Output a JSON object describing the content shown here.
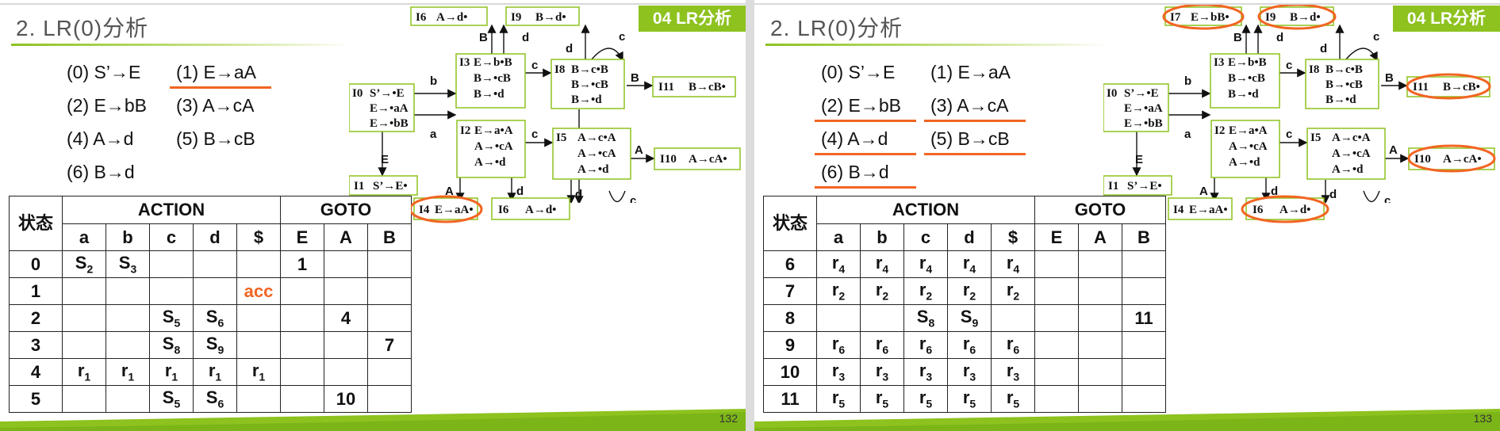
{
  "slides": [
    {
      "badge": "04 LR分析",
      "title": "2. LR(0)分析",
      "page": "132",
      "productions": [
        "(0)  S’→E",
        "(1)  E→aA",
        "(2)  E→bB",
        "(3)  A→cA",
        "(4)  A→d",
        "(5)  B→cB",
        "(6)  B→d"
      ],
      "underlined": [
        "(1)"
      ],
      "headers": {
        "state": "状态",
        "action": "ACTION",
        "goto": "GOTO",
        "cols": [
          "a",
          "b",
          "c",
          "d",
          "$",
          "E",
          "A",
          "B"
        ]
      },
      "rows": [
        [
          "0",
          "S2",
          "S3",
          "",
          "",
          "",
          "1",
          "",
          ""
        ],
        [
          "1",
          "",
          "",
          "",
          "",
          "acc",
          "",
          "",
          ""
        ],
        [
          "2",
          "",
          "",
          "S5",
          "S6",
          "",
          "",
          "4",
          ""
        ],
        [
          "3",
          "",
          "",
          "S8",
          "S9",
          "",
          "",
          "",
          "7"
        ],
        [
          "4",
          "r1",
          "r1",
          "r1",
          "r1",
          "r1",
          "",
          "",
          ""
        ],
        [
          "5",
          "",
          "",
          "S5",
          "S6",
          "",
          "",
          "10",
          ""
        ]
      ],
      "circled_states": [
        "I4"
      ]
    },
    {
      "badge": "04 LR分析",
      "title": "2. LR(0)分析",
      "page": "133",
      "productions": [
        "(0)  S’→E",
        "(1)  E→aA",
        "(2)  E→bB",
        "(3)  A→cA",
        "(4)  A→d",
        "(5)  B→cB",
        "(6)  B→d"
      ],
      "underlined": [
        "(2)",
        "(3)",
        "(4)",
        "(5)",
        "(6)"
      ],
      "headers": {
        "state": "状态",
        "action": "ACTION",
        "goto": "GOTO",
        "cols": [
          "a",
          "b",
          "c",
          "d",
          "$",
          "E",
          "A",
          "B"
        ]
      },
      "rows": [
        [
          "6",
          "r4",
          "r4",
          "r4",
          "r4",
          "r4",
          "",
          "",
          ""
        ],
        [
          "7",
          "r2",
          "r2",
          "r2",
          "r2",
          "r2",
          "",
          "",
          ""
        ],
        [
          "8",
          "",
          "",
          "S8",
          "S9",
          "",
          "",
          "",
          "11"
        ],
        [
          "9",
          "r6",
          "r6",
          "r6",
          "r6",
          "r6",
          "",
          "",
          ""
        ],
        [
          "10",
          "r3",
          "r3",
          "r3",
          "r3",
          "r3",
          "",
          "",
          ""
        ],
        [
          "11",
          "r5",
          "r5",
          "r5",
          "r5",
          "r5",
          "",
          "",
          ""
        ]
      ],
      "circled_states": [
        "I7",
        "I9",
        "I11",
        "I10",
        "I6"
      ]
    }
  ],
  "dfa": {
    "states": [
      {
        "id": "I0",
        "items": [
          "S’→•E",
          "E→•aA",
          "E→•bB"
        ]
      },
      {
        "id": "I1",
        "items": [
          "S’→E•"
        ]
      },
      {
        "id": "I2",
        "items": [
          "E→a•A",
          "A→•cA",
          "A→•d"
        ]
      },
      {
        "id": "I3",
        "items": [
          "E→b•B",
          "B→•cB",
          "B→•d"
        ]
      },
      {
        "id": "I4",
        "items": [
          "E→aA•"
        ]
      },
      {
        "id": "I5",
        "items": [
          "A→c•A",
          "A→•cA",
          "A→•d"
        ]
      },
      {
        "id": "I6",
        "items": [
          "A→d•"
        ]
      },
      {
        "id": "I7",
        "items": [
          "E→bB•"
        ]
      },
      {
        "id": "I8",
        "items": [
          "B→c•B",
          "B→•cB",
          "B→•d"
        ]
      },
      {
        "id": "I9",
        "items": [
          "B→d•"
        ]
      },
      {
        "id": "I10",
        "items": [
          "A→cA•"
        ]
      },
      {
        "id": "I11",
        "items": [
          "B→cB•"
        ]
      }
    ],
    "edge_labels": {
      "I0_I1": "E",
      "I0_I2": "a",
      "I0_I3": "b",
      "I2_I4": "A",
      "I2_I5": "c",
      "I2_I6": "d",
      "I3_I7": "B",
      "I3_I8": "c",
      "I3_I9": "d",
      "I5_I10": "A",
      "I5_loop": "c",
      "I5_I6": "d",
      "I8_I11": "B",
      "I8_loop": "c",
      "I8_I9": "d"
    }
  },
  "colors": {
    "accent_green": "#8dc21f",
    "accent_orange": "#f26522"
  }
}
